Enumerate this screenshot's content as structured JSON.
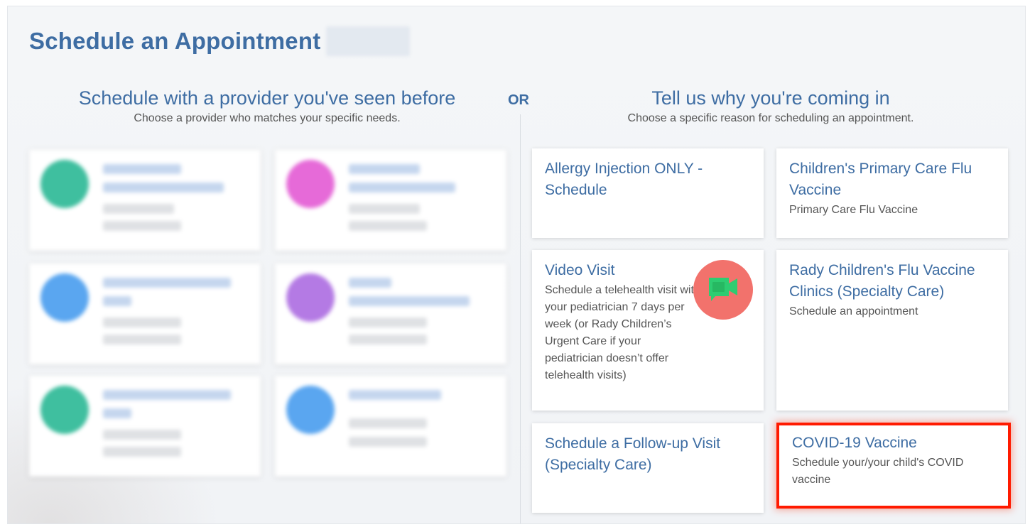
{
  "page": {
    "title": "Schedule an Appointment",
    "or_label": "OR"
  },
  "providers": {
    "heading": "Schedule with a provider you've seen before",
    "subheading": "Choose a provider who matches your specific needs.",
    "cards": [
      {
        "avatar_color": "#3fbf9f"
      },
      {
        "avatar_color": "#e66ad8"
      },
      {
        "avatar_color": "#5aa6f0"
      },
      {
        "avatar_color": "#b47ae4"
      },
      {
        "avatar_color": "#3fbf9f"
      },
      {
        "avatar_color": "#5aa6f0"
      }
    ]
  },
  "reasons": {
    "heading": "Tell us why you're coming in",
    "subheading": "Choose a specific reason for scheduling an appointment.",
    "items": [
      {
        "title": "Allergy Injection ONLY - Schedule",
        "description": ""
      },
      {
        "title": "Children's Primary Care Flu Vaccine",
        "description": "Primary Care Flu Vaccine"
      },
      {
        "title": "Video Visit",
        "description": "Schedule a telehealth visit with your pediatrician 7 days per week (or Rady Children’s Urgent Care if your pediatrician doesn’t offer telehealth visits)",
        "icon": "video-camera-icon"
      },
      {
        "title": "Rady Children's Flu Vaccine Clinics (Specialty Care)",
        "description": "Schedule an appointment"
      },
      {
        "title": "Schedule a Follow-up Visit (Specialty Care)",
        "description": ""
      },
      {
        "title": "COVID-19 Vaccine",
        "description": "Schedule your/your child's COVID vaccine"
      }
    ]
  },
  "colors": {
    "link_blue": "#3e6da3",
    "highlight_red": "#ff1a00",
    "video_icon_bg": "#f2726c",
    "video_icon_fg": "#2ecc71"
  }
}
